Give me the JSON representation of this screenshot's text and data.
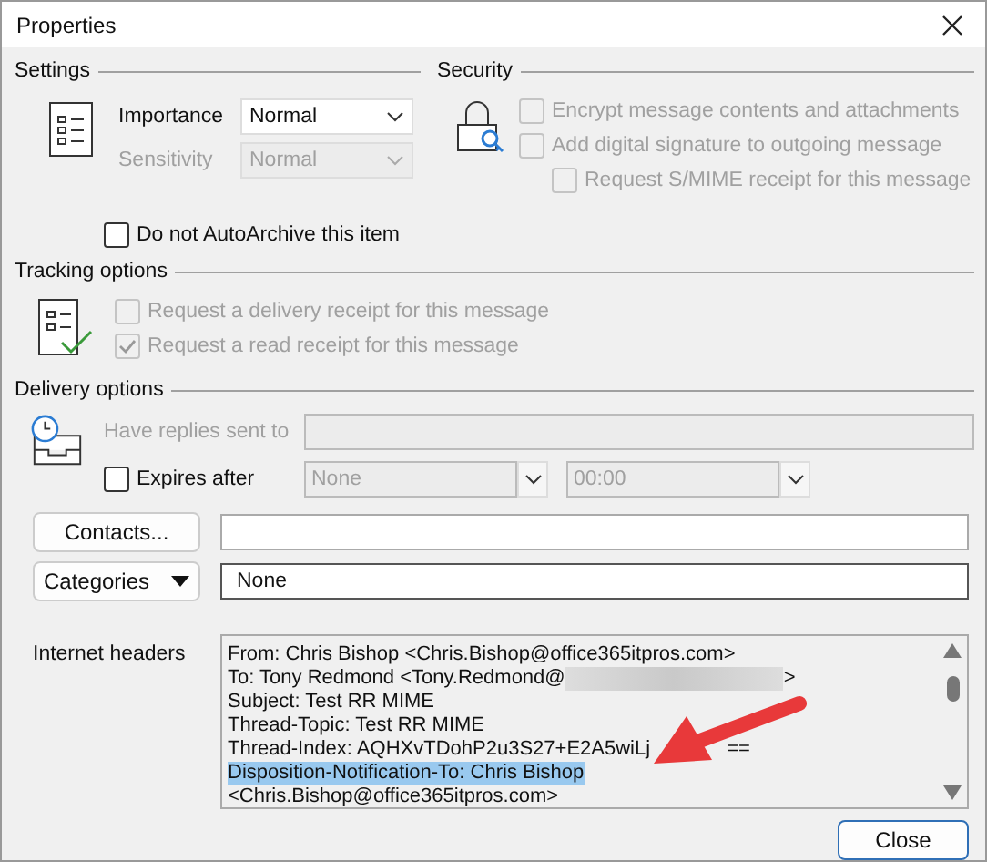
{
  "window": {
    "title": "Properties"
  },
  "settings": {
    "title": "Settings",
    "fields": [
      {
        "label": "Importance",
        "value": "Normal",
        "disabled": false
      },
      {
        "label": "Sensitivity",
        "value": "Normal",
        "disabled": true
      }
    ]
  },
  "security": {
    "title": "Security",
    "options": [
      {
        "label": "Encrypt message contents and attachments",
        "checked": false,
        "disabled": true,
        "indented": false
      },
      {
        "label": "Add digital signature to outgoing message",
        "checked": false,
        "disabled": true,
        "indented": false
      },
      {
        "label": "Request S/MIME receipt for this message",
        "checked": false,
        "disabled": true,
        "indented": true
      }
    ]
  },
  "auto_archive": {
    "label": "Do not AutoArchive this item",
    "checked": false
  },
  "tracking": {
    "title": "Tracking options",
    "options": [
      {
        "label": "Request a delivery receipt for this message",
        "checked": false,
        "disabled": true
      },
      {
        "label": "Request a read receipt for this message",
        "checked": true,
        "disabled": true
      }
    ]
  },
  "delivery": {
    "title": "Delivery options",
    "replies": {
      "label": "Have replies sent to",
      "disabled": true
    },
    "expires": {
      "label": "Expires after",
      "checked": false,
      "date": "None",
      "time": "00:00",
      "disabled": true
    }
  },
  "contacts": {
    "button": "Contacts..."
  },
  "categories": {
    "button": "Categories",
    "value": "None"
  },
  "headers": {
    "label": "Internet headers",
    "lines": [
      {
        "kind": "plain",
        "text": "From: Chris Bishop <Chris.Bishop@office365itpros.com>",
        "selected": false
      },
      {
        "kind": "redacted",
        "before": "To: Tony Redmond <Tony.Redmond@",
        "after": ">",
        "selected": false
      },
      {
        "kind": "plain",
        "text": "Subject: Test RR MIME",
        "selected": false
      },
      {
        "kind": "plain",
        "text": "Thread-Topic: Test RR MIME",
        "selected": false
      },
      {
        "kind": "covered",
        "before": "Thread-Index: AQHXvTDohP2u3S27+E2A5wiLj",
        "after": "==",
        "selected": false
      },
      {
        "kind": "plain",
        "text": "Disposition-Notification-To: Chris Bishop",
        "selected": true
      },
      {
        "kind": "plain",
        "text": "<Chris.Bishop@office365itpros.com>",
        "selected": false
      }
    ]
  },
  "buttons": [
    {
      "label": "Close",
      "default": true
    }
  ]
}
